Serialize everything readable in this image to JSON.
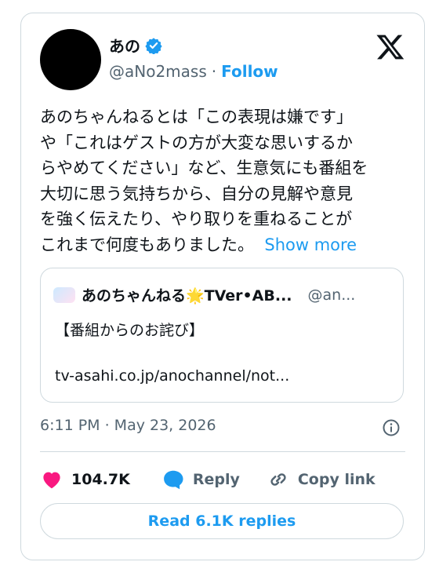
{
  "colors": {
    "accent": "#1d9bf0",
    "muted": "#536471",
    "like": "#f91880",
    "border": "#cfd9de"
  },
  "author": {
    "name": "あの",
    "handle": "@aNo2mass",
    "separator": "·",
    "follow_label": "Follow",
    "verified_icon": "verified-badge-icon",
    "avatar_icon": "avatar"
  },
  "post": {
    "text": "あのちゃんねるとは「この表現は嫌です」\nや「これはゲストの方が大変な思いするか\nらやめてください」など、生意気にも番組を\n大切に思う気持ちから、自分の見解や意見\nを強く伝えたり、やり取りを重ねることが\nこれまで何度もありました。",
    "show_more": "Show more"
  },
  "quote": {
    "name": "あのちゃんねる🌟TVer•AB...",
    "handle": "@an...",
    "title": "【番組からのお詫び】",
    "link": "tv-asahi.co.jp/anochannel/not..."
  },
  "meta": {
    "timestamp": "6:11 PM · May 23, 2026"
  },
  "actions": {
    "like_count": "104.7K",
    "reply_label": "Reply",
    "copy_label": "Copy link",
    "read_replies": "Read 6.1K replies"
  }
}
